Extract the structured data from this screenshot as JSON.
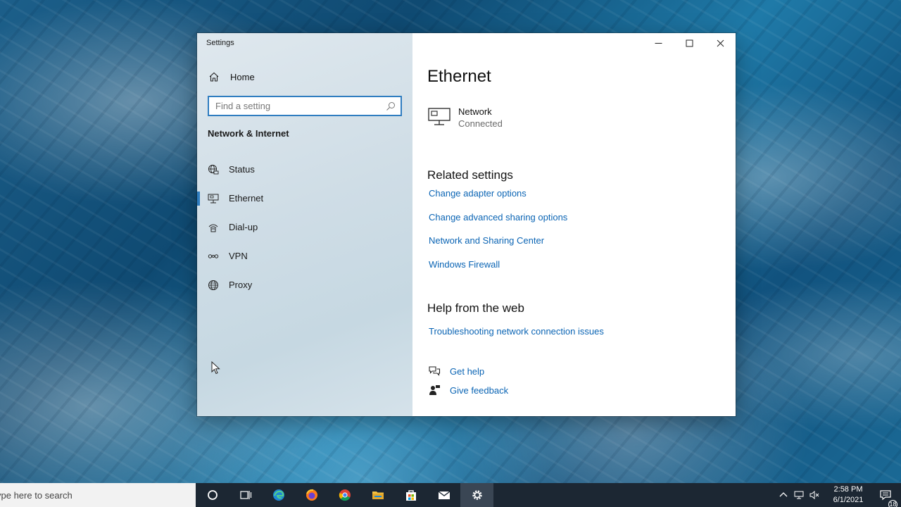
{
  "window": {
    "title": "Settings",
    "controls": {
      "minimize": "minimize-icon",
      "maximize": "maximize-icon",
      "close": "close-icon"
    }
  },
  "sidebar": {
    "home_label": "Home",
    "search_placeholder": "Find a setting",
    "section_title": "Network & Internet",
    "items": [
      {
        "label": "Status",
        "icon": "globe-status-icon"
      },
      {
        "label": "Ethernet",
        "icon": "ethernet-icon",
        "active": true
      },
      {
        "label": "Dial-up",
        "icon": "dialup-icon"
      },
      {
        "label": "VPN",
        "icon": "vpn-icon"
      },
      {
        "label": "Proxy",
        "icon": "globe-icon"
      }
    ]
  },
  "main": {
    "title": "Ethernet",
    "network": {
      "name": "Network",
      "status": "Connected"
    },
    "related_heading": "Related settings",
    "related_links": [
      "Change adapter options",
      "Change advanced sharing options",
      "Network and Sharing Center",
      "Windows Firewall"
    ],
    "help_heading": "Help from the web",
    "help_links": [
      "Troubleshooting network connection issues"
    ],
    "get_help_label": "Get help",
    "give_feedback_label": "Give feedback"
  },
  "taskbar": {
    "search_text": "ype here to search",
    "time": "2:58 PM",
    "date": "6/1/2021",
    "notification_count": "18"
  },
  "colors": {
    "accent": "#2f7dc0",
    "link": "#0a64b4",
    "taskbar": "#1c2733"
  }
}
